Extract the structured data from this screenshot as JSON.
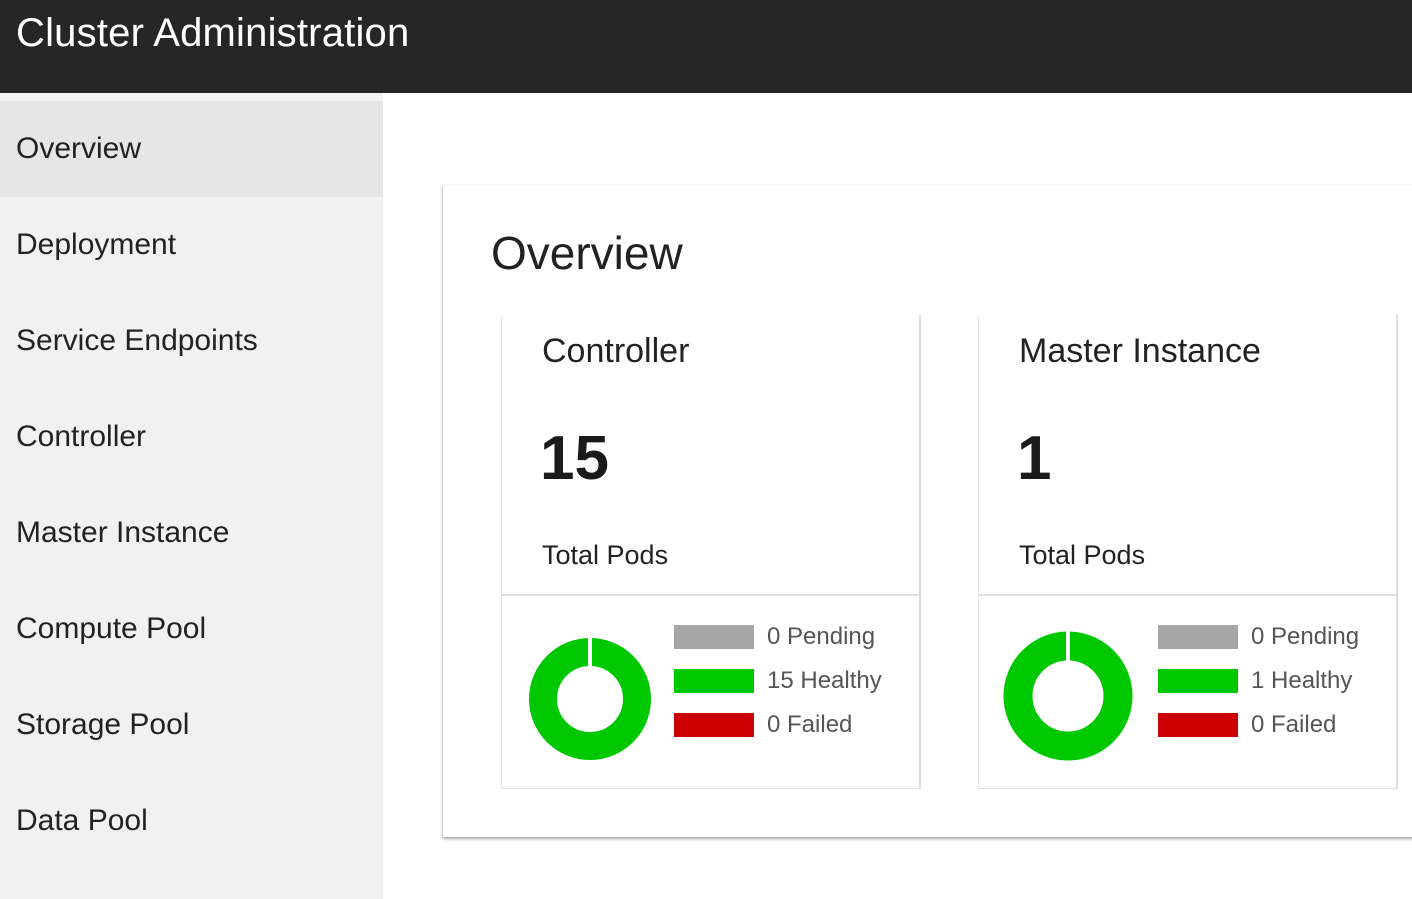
{
  "app": {
    "title": "Cluster Administration"
  },
  "sidebar": {
    "items": [
      {
        "label": "Overview",
        "active": true
      },
      {
        "label": "Deployment"
      },
      {
        "label": "Service Endpoints"
      },
      {
        "label": "Controller"
      },
      {
        "label": "Master Instance"
      },
      {
        "label": "Compute Pool"
      },
      {
        "label": "Storage Pool"
      },
      {
        "label": "Data Pool"
      }
    ]
  },
  "main": {
    "title": "Overview",
    "cards": [
      {
        "title": "Controller",
        "count": "15",
        "count_label": "Total Pods",
        "legend": [
          {
            "label": "0 Pending",
            "color": "#a6a6a6"
          },
          {
            "label": "15 Healthy",
            "color": "#00c800"
          },
          {
            "label": "0 Failed",
            "color": "#cc0000"
          }
        ]
      },
      {
        "title": "Master Instance",
        "count": "1",
        "count_label": "Total Pods",
        "legend": [
          {
            "label": "0 Pending",
            "color": "#a6a6a6"
          },
          {
            "label": "1 Healthy",
            "color": "#00c800"
          },
          {
            "label": "0 Failed",
            "color": "#cc0000"
          }
        ]
      }
    ]
  },
  "colors": {
    "topbar": "#262626",
    "sidebar": "#f1f1f1",
    "sidebar_active": "#e6e6e6",
    "healthy": "#00c800",
    "pending": "#a6a6a6",
    "failed": "#cc0000"
  }
}
